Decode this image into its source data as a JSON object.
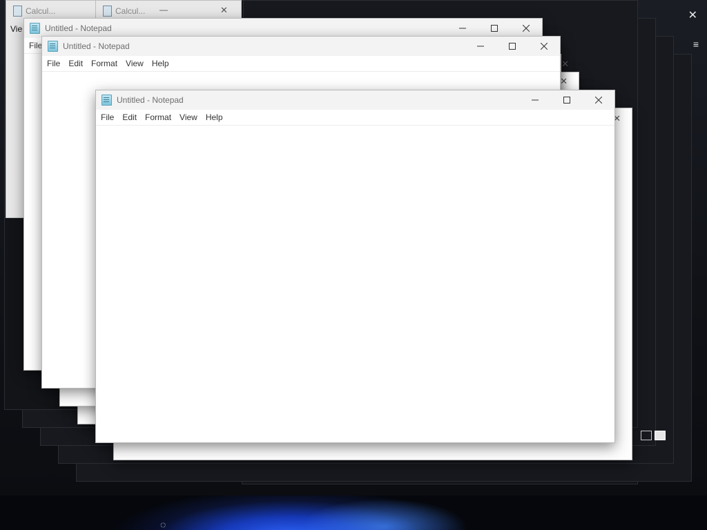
{
  "calculator": {
    "title_1": "Calcul...",
    "title_2": "Calcul...",
    "menu_view_fragment": "Vie"
  },
  "notepad_windows": {
    "title": "Untitled - Notepad",
    "menu": [
      "File",
      "Edit",
      "Format",
      "View",
      "Help"
    ],
    "back_menu_fragment": "File"
  },
  "window_controls": {
    "minimize": "—",
    "maximize": "☐",
    "close": "✕"
  },
  "overlay": {
    "close_glyph": "✕",
    "menu_glyph": "≡"
  },
  "icons": {
    "app_icon": "notepad-icon",
    "calc_icon": "calculator-icon",
    "cursor": "busy-cursor-icon"
  }
}
